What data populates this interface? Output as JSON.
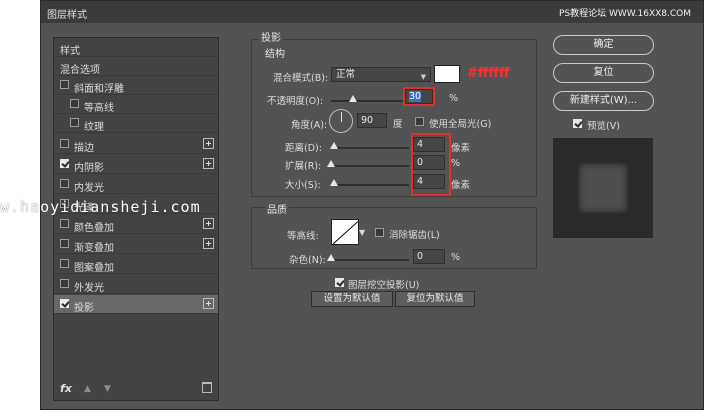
{
  "window": {
    "title": "图层样式"
  },
  "watermark_top": "PS教程论坛 WWW.16XX8.COM",
  "watermark_mid": "w.haoyidiansheji.com",
  "sidebar": {
    "items": [
      {
        "label": "样式",
        "checkbox": false,
        "plus": false
      },
      {
        "label": "混合选项",
        "checkbox": false,
        "plus": false
      },
      {
        "label": "斜面和浮雕",
        "checkbox": true,
        "checked": false,
        "plus": false
      },
      {
        "label": "等高线",
        "checkbox": true,
        "checked": false,
        "plus": false,
        "indent": true
      },
      {
        "label": "纹理",
        "checkbox": true,
        "checked": false,
        "plus": false,
        "indent": true
      },
      {
        "label": "描边",
        "checkbox": true,
        "checked": false,
        "plus": true
      },
      {
        "label": "内阴影",
        "checkbox": true,
        "checked": true,
        "plus": true
      },
      {
        "label": "内发光",
        "checkbox": true,
        "checked": false,
        "plus": false
      },
      {
        "label": "光泽",
        "checkbox": true,
        "checked": false,
        "plus": false
      },
      {
        "label": "颜色叠加",
        "checkbox": true,
        "checked": false,
        "plus": true
      },
      {
        "label": "渐变叠加",
        "checkbox": true,
        "checked": false,
        "plus": true
      },
      {
        "label": "图案叠加",
        "checkbox": true,
        "checked": false,
        "plus": false
      },
      {
        "label": "外发光",
        "checkbox": true,
        "checked": false,
        "plus": false
      },
      {
        "label": "投影",
        "checkbox": true,
        "checked": true,
        "plus": true,
        "selected": true
      }
    ],
    "footer": {
      "fx": "fx",
      "up": "▲",
      "down": "▼"
    }
  },
  "drop_shadow": {
    "group_title": "投影",
    "structure_title": "结构",
    "blend_mode_label": "混合模式(B):",
    "blend_mode_value": "正常",
    "color_annotation": "#ffffff",
    "opacity_label": "不透明度(O):",
    "opacity_value": "30",
    "opacity_unit": "%",
    "angle_label": "角度(A):",
    "angle_value": "90",
    "angle_unit": "度",
    "global_light_label": "使用全局光(G)",
    "distance_label": "距离(D):",
    "distance_value": "4",
    "distance_unit": "像素",
    "spread_label": "扩展(R):",
    "spread_value": "0",
    "spread_unit": "%",
    "size_label": "大小(S):",
    "size_value": "4",
    "size_unit": "像素",
    "quality_title": "品质",
    "contour_label": "等高线:",
    "antialias_label": "消除锯齿(L)",
    "noise_label": "杂色(N):",
    "noise_value": "0",
    "noise_unit": "%",
    "knockout_label": "图层挖空投影(U)",
    "set_default_label": "设置为默认值",
    "reset_default_label": "复位为默认值"
  },
  "right_buttons": {
    "ok": "确定",
    "reset": "复位",
    "new_style": "新建样式(W)...",
    "preview_label": "预览(V)"
  },
  "colors": {
    "window_bg": "#535353",
    "sidebar_bg": "#434343",
    "annotation_red": "#e23030",
    "selection": "#3d6fc4"
  },
  "levels": {
    "opacity": 0.3,
    "distance": 0.04,
    "spread": 0.0,
    "size": 0.04,
    "noise": 0.0
  }
}
